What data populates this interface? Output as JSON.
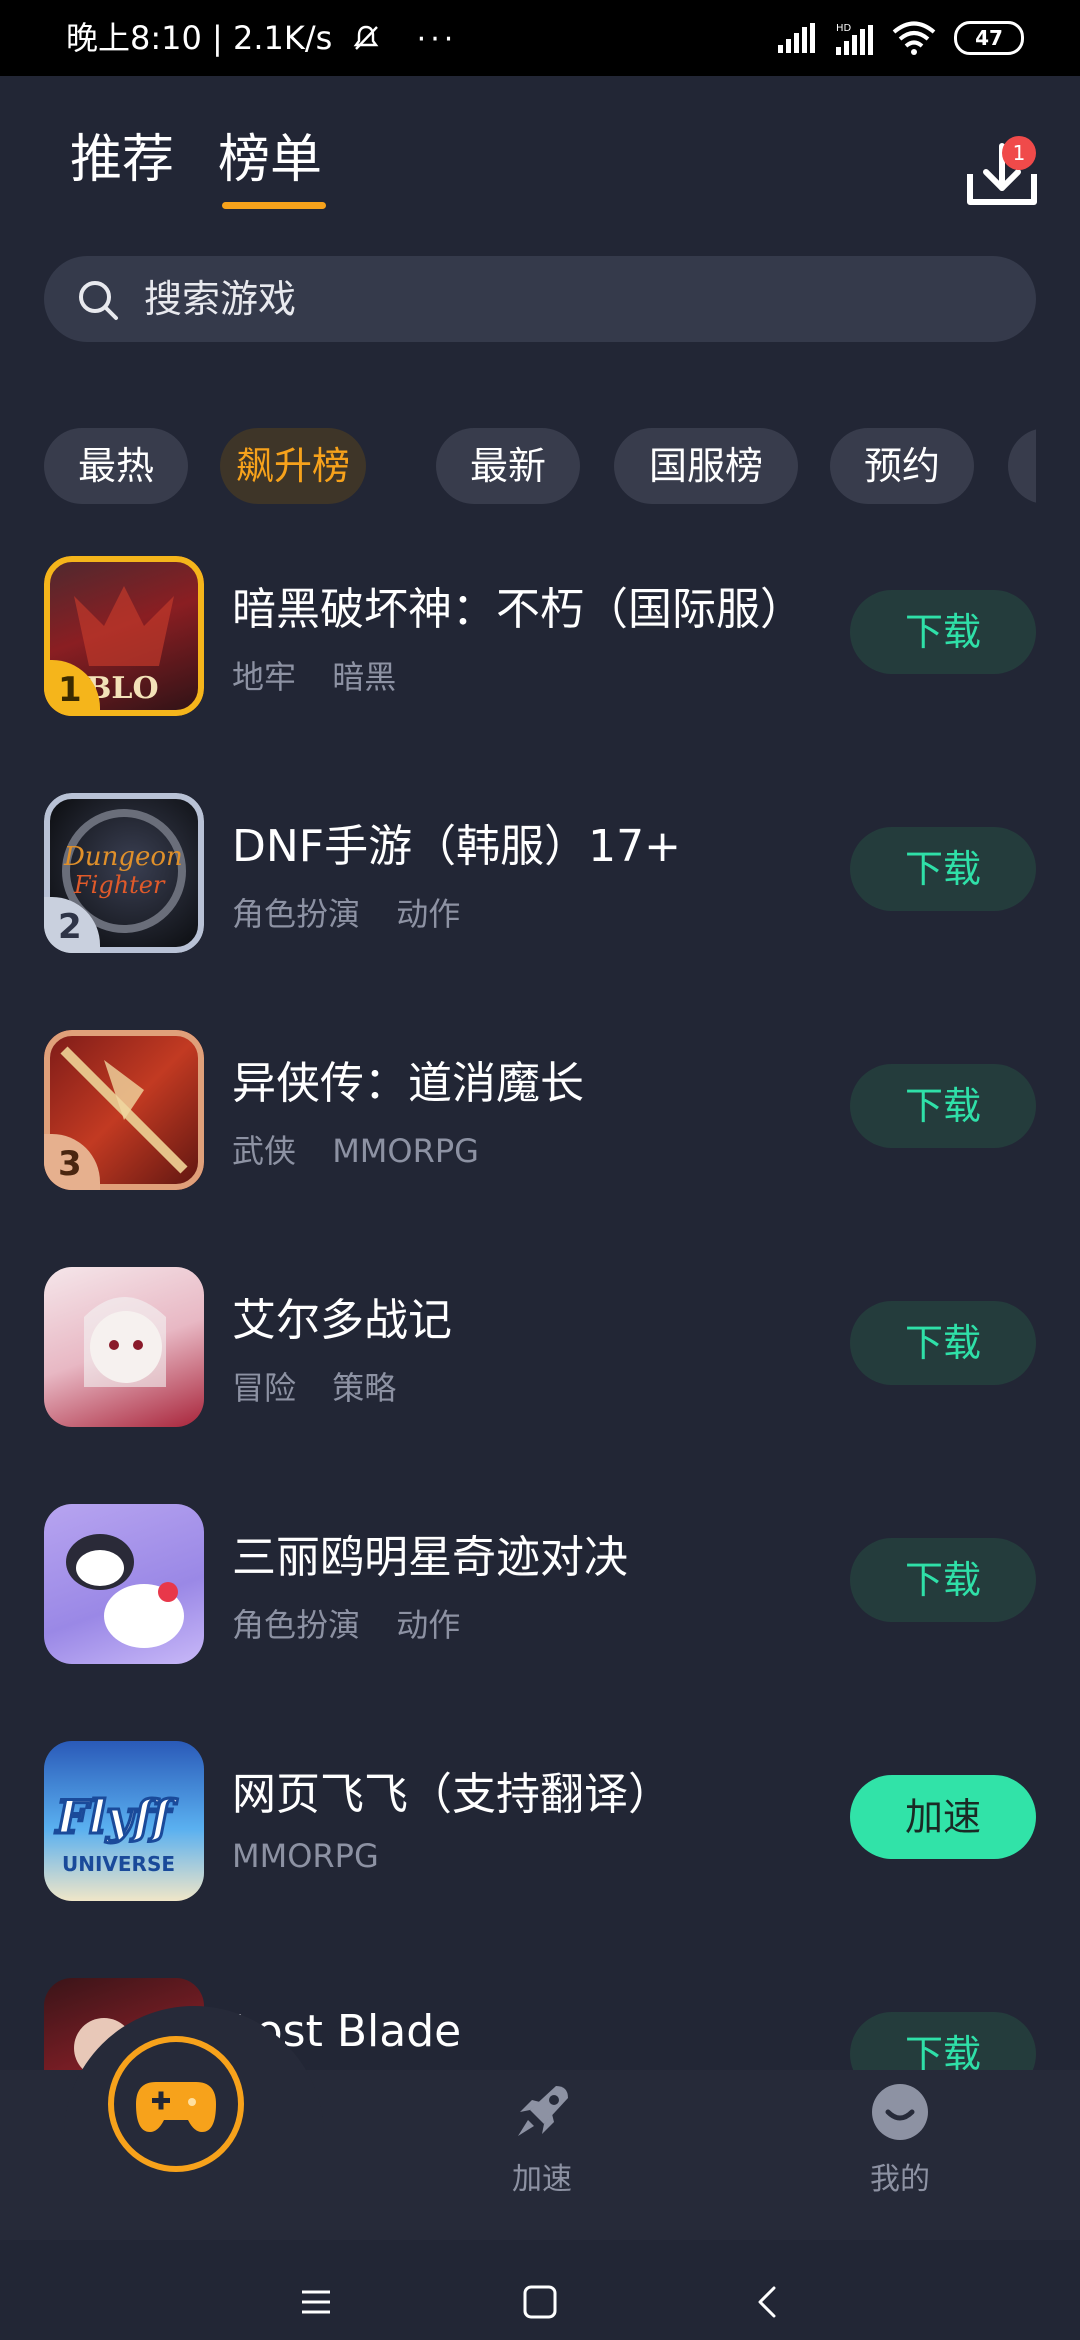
{
  "status_bar": {
    "time_speed": "晚上8:10 | 2.1K/s",
    "more": "···",
    "battery": "47"
  },
  "header": {
    "tabs": [
      {
        "label": "推荐",
        "active": false
      },
      {
        "label": "榜单",
        "active": true
      }
    ],
    "download_badge": "1",
    "download_icon": "download-icon"
  },
  "search": {
    "placeholder": "搜索游戏",
    "icon": "search-icon"
  },
  "categories": [
    {
      "label": "最热",
      "active": false
    },
    {
      "label": "飙升榜",
      "active": true
    },
    {
      "label": "最新",
      "active": false
    },
    {
      "label": "国服榜",
      "active": false
    },
    {
      "label": "预约",
      "active": false
    }
  ],
  "games": [
    {
      "rank": "1",
      "title": "暗黑破坏神：不朽（国际服）",
      "tags": [
        "地牢",
        "暗黑"
      ],
      "action": "下载",
      "primary": false
    },
    {
      "rank": "2",
      "title": "DNF手游（韩服）17+",
      "tags": [
        "角色扮演",
        "动作"
      ],
      "action": "下载",
      "primary": false
    },
    {
      "rank": "3",
      "title": "异侠传：道消魔长",
      "tags": [
        "武侠",
        "MMORPG"
      ],
      "action": "下载",
      "primary": false
    },
    {
      "rank": "",
      "title": "艾尔多战记",
      "tags": [
        "冒险",
        "策略"
      ],
      "action": "下载",
      "primary": false
    },
    {
      "rank": "",
      "title": "三丽鸥明星奇迹对决",
      "tags": [
        "角色扮演",
        "动作"
      ],
      "action": "下载",
      "primary": false
    },
    {
      "rank": "",
      "title": "网页飞飞（支持翻译）",
      "tags": [
        "MMORPG"
      ],
      "action": "加速",
      "primary": true
    },
    {
      "rank": "",
      "title": "Lost Blade",
      "tags": [],
      "action": "下载",
      "primary": false
    }
  ],
  "bottom_nav": {
    "items": [
      {
        "label": "",
        "icon": "gamepad-icon"
      },
      {
        "label": "加速",
        "icon": "rocket-icon"
      },
      {
        "label": "我的",
        "icon": "profile-icon"
      }
    ]
  },
  "colors": {
    "accent": "#f7a21b",
    "download_green": "#2fe0a8",
    "background": "#222635"
  }
}
